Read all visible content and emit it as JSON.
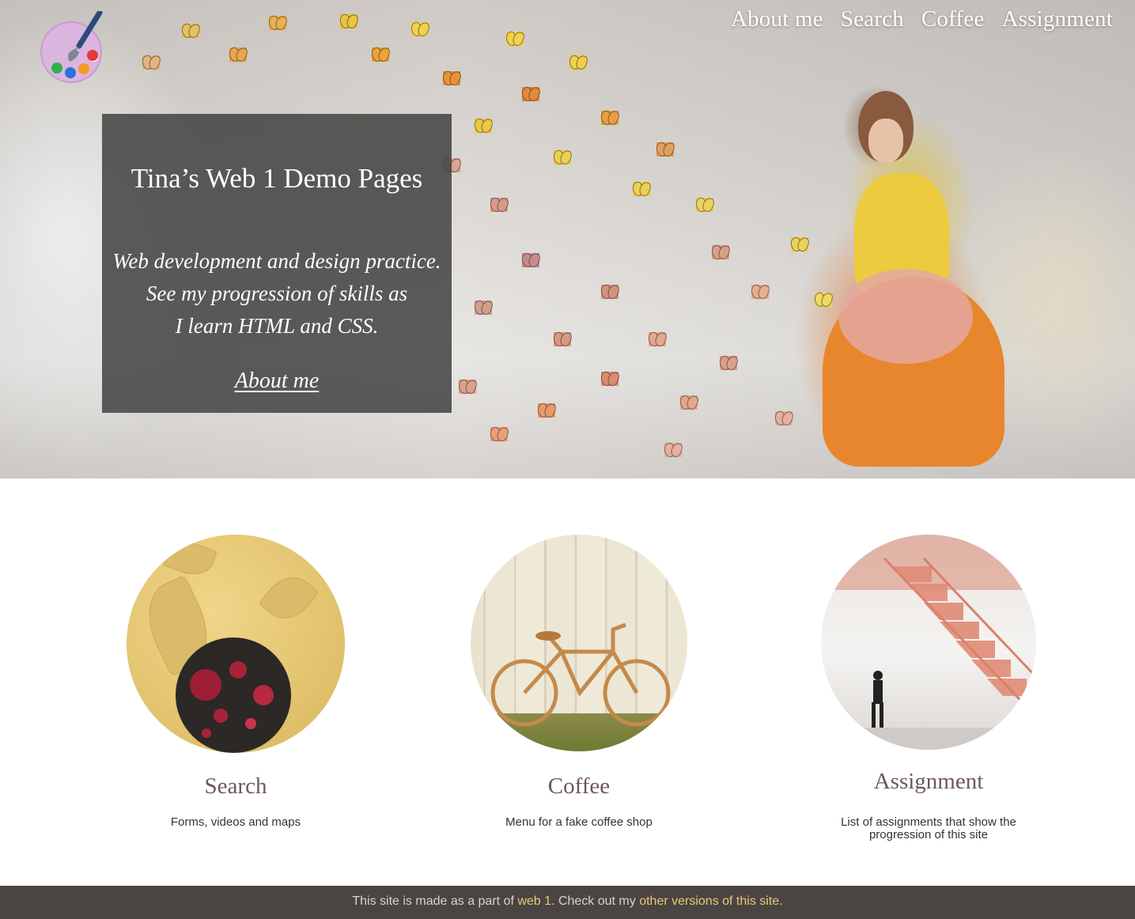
{
  "nav": {
    "items": [
      {
        "label": "About me"
      },
      {
        "label": "Search"
      },
      {
        "label": "Coffee"
      },
      {
        "label": "Assignment"
      }
    ]
  },
  "hero": {
    "title": "Tina’s Web 1 Demo Pages",
    "text": "Web development and design practice.\nSee my progression of skills  as\nI learn  HTML  and CSS.",
    "link_label": "About me"
  },
  "cards": [
    {
      "title": "Search",
      "description": "Forms, videos and maps"
    },
    {
      "title": "Coffee",
      "description": "Menu for a fake coffee shop"
    },
    {
      "title": "Assignment",
      "description": "List of assignments that show the progression of this site"
    }
  ],
  "footer": {
    "prefix": "This site is made as a part of ",
    "link1": "web 1",
    "middle": ". Check out my ",
    "link2": "other versions of this site",
    "suffix": "."
  },
  "colors": {
    "footer_bg": "#4a4442",
    "footer_link": "#e8c878",
    "card_title": "#6b5a58",
    "hero_box": "#464646"
  },
  "icons": {
    "logo": "paint-palette-icon"
  }
}
